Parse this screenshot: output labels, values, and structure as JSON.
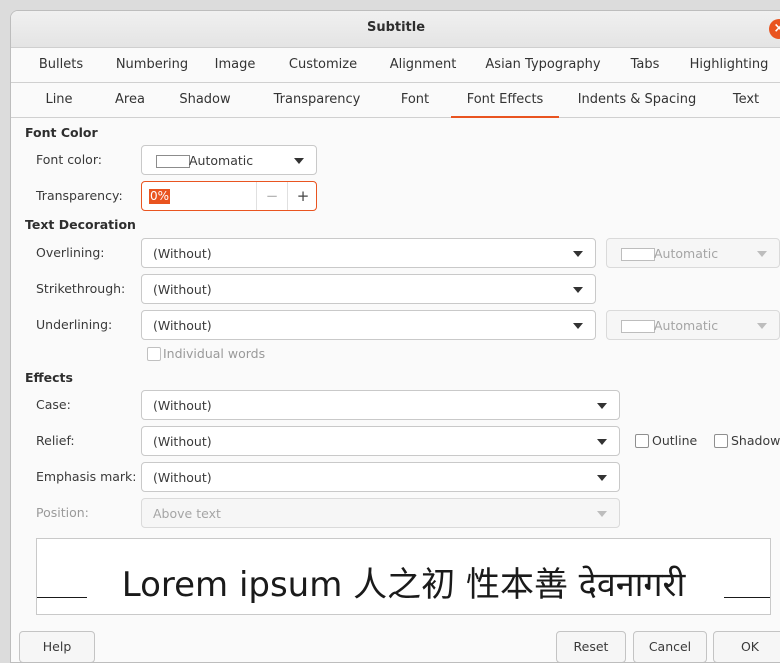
{
  "dialog": {
    "title": "Subtitle"
  },
  "tabs_row1": [
    "Bullets",
    "Numbering",
    "Image",
    "Customize",
    "Alignment",
    "Asian Typography",
    "Tabs",
    "Highlighting"
  ],
  "tabs_row2": [
    "Line",
    "Area",
    "Shadow",
    "Transparency",
    "Font",
    "Font Effects",
    "Indents & Spacing",
    "Text"
  ],
  "active_tab": "Font Effects",
  "font_color": {
    "section": "Font Color",
    "font_color_label": "Font color:",
    "font_color_value": "Automatic",
    "transparency_label": "Transparency:",
    "transparency_value": "0%"
  },
  "text_decoration": {
    "section": "Text Decoration",
    "overlining_label": "Overlining:",
    "overlining_value": "(Without)",
    "overline_color": "Automatic",
    "strikethrough_label": "Strikethrough:",
    "strikethrough_value": "(Without)",
    "underlining_label": "Underlining:",
    "underlining_value": "(Without)",
    "underline_color": "Automatic",
    "individual_words": "Individual words"
  },
  "effects": {
    "section": "Effects",
    "case_label": "Case:",
    "case_value": "(Without)",
    "relief_label": "Relief:",
    "relief_value": "(Without)",
    "outline_label": "Outline",
    "shadow_label": "Shadow",
    "emphasis_label": "Emphasis mark:",
    "emphasis_value": "(Without)",
    "position_label": "Position:",
    "position_value": "Above text"
  },
  "preview": {
    "text": "Lorem ipsum   人之初 性本善  देवनागरी"
  },
  "buttons": {
    "help": "Help",
    "reset": "Reset",
    "cancel": "Cancel",
    "ok": "OK"
  },
  "colors": {
    "accent": "#e95420"
  }
}
